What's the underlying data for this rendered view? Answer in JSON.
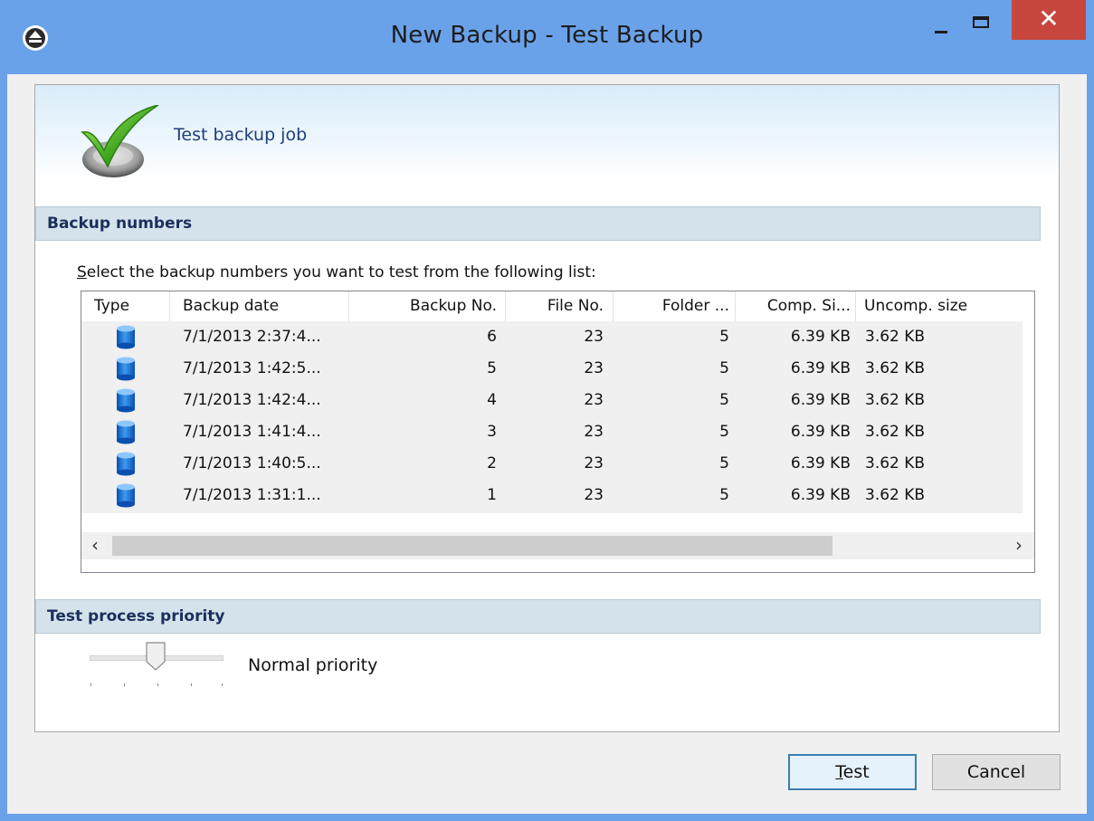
{
  "window": {
    "title": "New Backup - Test Backup",
    "close_glyph": "✕",
    "accent_color": "#6aa2ea",
    "close_color": "#c7463e"
  },
  "header": {
    "title": "Test backup job",
    "icon": "green-checkmark-icon"
  },
  "sections": {
    "backup_numbers": "Backup numbers",
    "priority": "Test process priority"
  },
  "instruction": {
    "accel": "S",
    "rest": "elect the backup numbers you want to test from the following list:"
  },
  "table": {
    "columns": [
      "Type",
      "Backup date",
      "Backup No.",
      "File No.",
      "Folder ...",
      "Comp. Si...",
      "Uncomp. size"
    ],
    "rows": [
      {
        "date": "7/1/2013 2:37:4...",
        "backup_no": "6",
        "file_no": "23",
        "folder": "5",
        "comp": "6.39 KB",
        "uncomp": "3.62 KB"
      },
      {
        "date": "7/1/2013 1:42:5...",
        "backup_no": "5",
        "file_no": "23",
        "folder": "5",
        "comp": "6.39 KB",
        "uncomp": "3.62 KB"
      },
      {
        "date": "7/1/2013 1:42:4...",
        "backup_no": "4",
        "file_no": "23",
        "folder": "5",
        "comp": "6.39 KB",
        "uncomp": "3.62 KB"
      },
      {
        "date": "7/1/2013 1:41:4...",
        "backup_no": "3",
        "file_no": "23",
        "folder": "5",
        "comp": "6.39 KB",
        "uncomp": "3.62 KB"
      },
      {
        "date": "7/1/2013 1:40:5...",
        "backup_no": "2",
        "file_no": "23",
        "folder": "5",
        "comp": "6.39 KB",
        "uncomp": "3.62 KB"
      },
      {
        "date": "7/1/2013 1:31:1...",
        "backup_no": "1",
        "file_no": "23",
        "folder": "5",
        "comp": "6.39 KB",
        "uncomp": "3.62 KB"
      }
    ],
    "row_icon": "database-icon",
    "scroll_left": "‹",
    "scroll_right": "›"
  },
  "priority": {
    "label": "Normal priority",
    "slider_level": 0.5
  },
  "buttons": {
    "test_accel": "T",
    "test_rest": "est",
    "cancel": "Cancel"
  }
}
